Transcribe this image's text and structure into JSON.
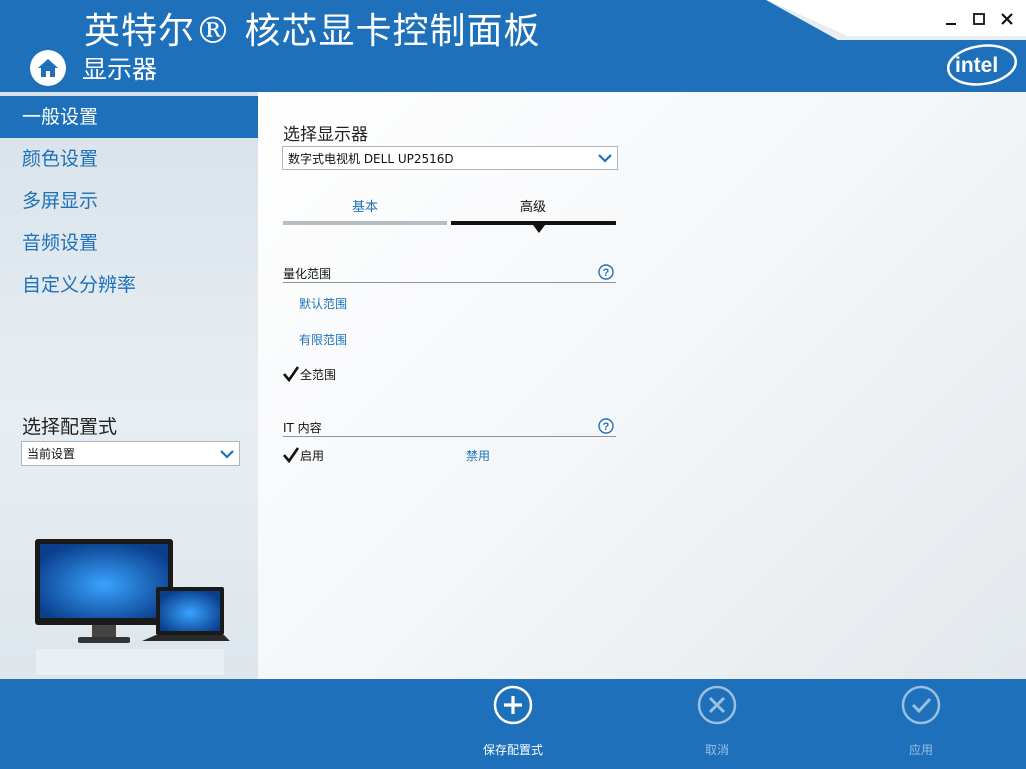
{
  "header": {
    "app_title": "英特尔® 核芯显卡控制面板",
    "section_title": "显示器",
    "logo_text": "intel"
  },
  "window_controls": {
    "minimize": "–",
    "maximize": "☐",
    "close": "✕"
  },
  "sidebar": {
    "items": [
      {
        "label": "一般设置",
        "active": true
      },
      {
        "label": "颜色设置",
        "active": false
      },
      {
        "label": "多屏显示",
        "active": false
      },
      {
        "label": "音频设置",
        "active": false
      },
      {
        "label": "自定义分辨率",
        "active": false
      }
    ],
    "profile_label": "选择配置式",
    "profile_value": "当前设置"
  },
  "main": {
    "display_label": "选择显示器",
    "display_value": "数字式电视机 DELL UP2516D",
    "tabs": [
      {
        "label": "基本",
        "active": false
      },
      {
        "label": "高级",
        "active": true
      }
    ],
    "quant_title": "量化范围",
    "quant_options": [
      {
        "label": "默认范围",
        "checked": false
      },
      {
        "label": "有限范围",
        "checked": false
      },
      {
        "label": "全范围",
        "checked": true
      }
    ],
    "it_title": "IT 内容",
    "it_options": [
      {
        "label": "启用",
        "checked": true
      },
      {
        "label": "禁用",
        "checked": false
      }
    ]
  },
  "footer": {
    "save_label": "保存配置式",
    "cancel_label": "取消",
    "apply_label": "应用"
  },
  "colors": {
    "brand_blue": "#1d70b9",
    "disabled_blue": "#9bbfe0"
  }
}
